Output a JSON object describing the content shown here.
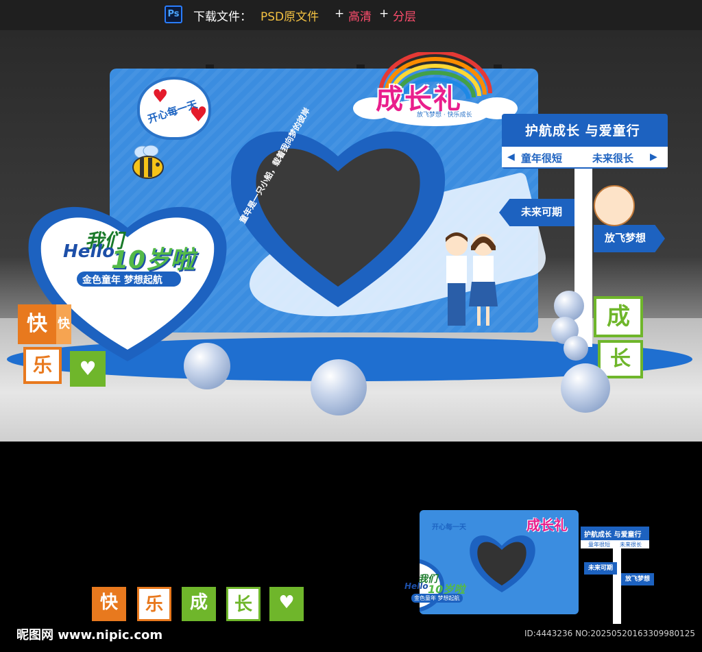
{
  "header": {
    "ps_badge": "Ps",
    "download_label": "下载文件：",
    "psd_label": "PSD原文件",
    "plus1": "+",
    "hd_label": "高清",
    "plus2": "+",
    "layers_label": "分层"
  },
  "backdrop": {
    "speech_text": "开心每一天",
    "arc_text": "童年是一只小船，载着我向梦的彼岸",
    "logo_main": "成长礼",
    "logo_sub": "放飞梦想 · 快乐成长"
  },
  "sign": {
    "title": "护航成长 与爱童行",
    "left_text": "童年很短",
    "right_text": "未来很长",
    "arrow_left": "◀",
    "arrow_right": "▶",
    "arrow1": "未来可期",
    "arrow2": "放飞梦想"
  },
  "left_heart": {
    "hello": "Hello",
    "women": "我们",
    "ten": "10岁啦",
    "slogan": "金色童年  梦想起航"
  },
  "cubes": {
    "left_top": "快",
    "left_side": "快",
    "left_bottom": "乐",
    "left_heart": "♥",
    "right_top": "成",
    "right_bottom": "长"
  },
  "bottom_cubes": [
    {
      "label": "快",
      "color": "#e8791e"
    },
    {
      "label": "乐",
      "color": "#e8791e"
    },
    {
      "label": "成",
      "color": "#6fb62b"
    },
    {
      "label": "长",
      "color": "#6fb62b"
    },
    {
      "label": "♥",
      "color": "#6fb62b"
    }
  ],
  "thumbnail": {
    "speech_text": "开心每一天",
    "logo_main": "成长礼",
    "sign_title": "护航成长 与爱童行",
    "left_text": "童年很短",
    "right_text": "未来很长",
    "arrow1": "未来可期",
    "arrow2": "放飞梦想",
    "women": "我们",
    "hello": "Hello",
    "ten": "10岁啦",
    "slogan": "金色童年 梦想起航"
  },
  "footer": {
    "site_logo": "昵图网 www.nipic.com",
    "id_text": "ID:4443236 NO:20250520163309980125"
  },
  "colors": {
    "backdrop_blue": "#3b8de0",
    "deep_blue": "#1d62c0",
    "orange": "#e8791e",
    "green": "#6fb62b",
    "magenta": "#e91e8c"
  }
}
